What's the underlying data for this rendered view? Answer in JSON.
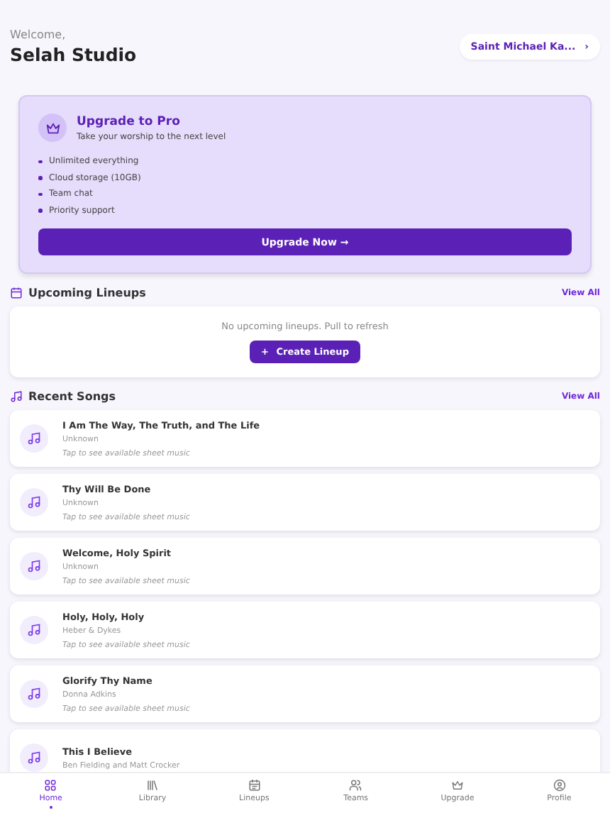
{
  "header": {
    "greeting": "Welcome,",
    "name": "Selah Studio",
    "church_chip": "Saint Michael Ka...",
    "chip_chevron": "›"
  },
  "upgrade_card": {
    "title": "Upgrade to Pro",
    "subtitle": "Take your worship to the next level",
    "features": [
      "Unlimited everything",
      "Cloud storage (10GB)",
      "Team chat",
      "Priority support"
    ],
    "button": "Upgrade Now",
    "button_arrow": "→"
  },
  "upcoming": {
    "title": "Upcoming Lineups",
    "view_all": "View All",
    "empty_text": "No upcoming lineups. Pull to refresh",
    "create_button": "Create Lineup",
    "create_plus": "+"
  },
  "recent": {
    "title": "Recent Songs",
    "view_all": "View All",
    "songs": [
      {
        "title": "I Am The Way, The Truth, and The Life",
        "artist": "Unknown",
        "hint": "Tap to see available sheet music"
      },
      {
        "title": "Thy Will Be Done",
        "artist": "Unknown",
        "hint": "Tap to see available sheet music"
      },
      {
        "title": "Welcome, Holy Spirit",
        "artist": "Unknown",
        "hint": "Tap to see available sheet music"
      },
      {
        "title": "Holy, Holy, Holy",
        "artist": "Heber & Dykes",
        "hint": "Tap to see available sheet music"
      },
      {
        "title": "Glorify Thy Name",
        "artist": "Donna Adkins",
        "hint": "Tap to see available sheet music"
      },
      {
        "title": "This I Believe",
        "artist": "Ben Fielding and Matt Crocker"
      }
    ]
  },
  "bottom_nav": [
    {
      "kind": "home",
      "label": "Home",
      "selected": true
    },
    {
      "kind": "library",
      "label": "Library",
      "selected": false
    },
    {
      "kind": "lineups",
      "label": "Lineups",
      "selected": false
    },
    {
      "kind": "teams",
      "label": "Teams",
      "selected": false
    },
    {
      "kind": "upgrade",
      "label": "Upgrade",
      "selected": false
    },
    {
      "kind": "profile",
      "label": "Profile",
      "selected": false
    }
  ]
}
